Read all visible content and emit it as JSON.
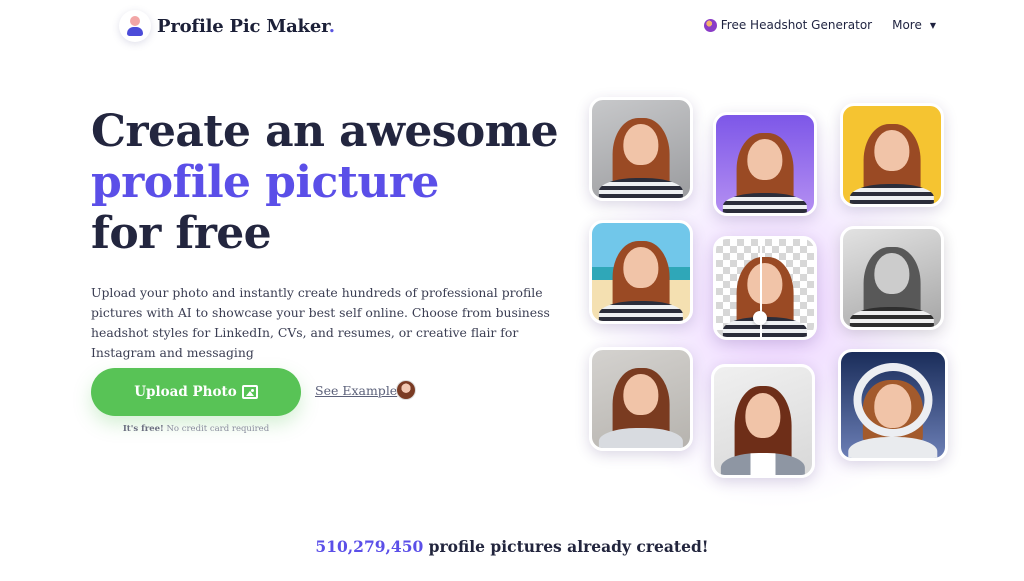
{
  "header": {
    "logo_text": "Profile Pic Maker",
    "logo_dot": ".",
    "nav": {
      "headshot_label": "Free Headshot Generator",
      "more_label": "More",
      "more_caret": "▼"
    }
  },
  "hero": {
    "title_line1": "Create an awesome",
    "title_accent": "profile picture",
    "title_line3": "for free",
    "description": "Upload your photo and instantly create hundreds of professional profile pictures with AI to showcase your best self online. Choose from business headshot styles for LinkedIn, CVs, and resumes, or creative flair for Instagram and messaging",
    "upload_label": "Upload Photo",
    "example_label": "See Example",
    "free_bold": "It's free!",
    "free_rest": "No credit card required"
  },
  "stats": {
    "count": "510,279,450",
    "suffix": "profile pictures already created!"
  },
  "colors": {
    "accent": "#5b4fe8",
    "button": "#58c356",
    "text": "#23263f"
  }
}
